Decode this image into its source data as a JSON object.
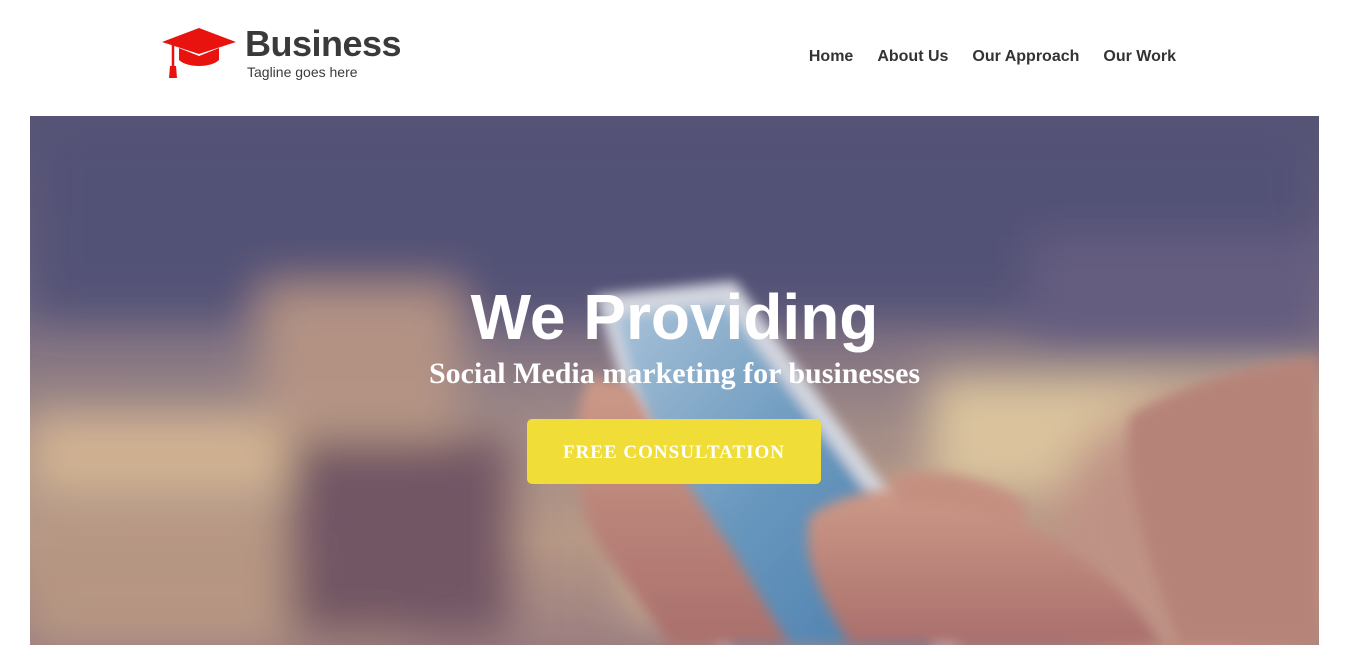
{
  "header": {
    "brand": "Business",
    "tagline": "Tagline goes here",
    "logo_icon": "graduation-cap-icon",
    "logo_color": "#e8130f"
  },
  "nav": {
    "items": [
      {
        "label": "Home"
      },
      {
        "label": "About Us"
      },
      {
        "label": "Our Approach"
      },
      {
        "label": "Our Work"
      }
    ]
  },
  "hero": {
    "title": "We Providing",
    "subtitle": "Social Media marketing for businesses",
    "cta_label": "FREE CONSULTATION",
    "cta_color": "#f0dd38",
    "background_image": "hands-holding-smartphone-photo"
  }
}
